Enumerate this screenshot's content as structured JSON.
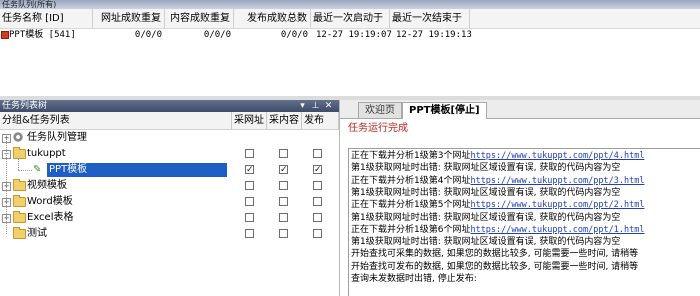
{
  "queue": {
    "title": "任务队列(所有)",
    "columns": [
      "任务名称 [ID]",
      "网址成败重复",
      "内容成败重复",
      "发布成败总数",
      "最近一次启动于",
      "最近一次结束于"
    ],
    "rows": [
      {
        "name": "PPT模板 [541]",
        "url_stats": "0/0/0",
        "content_stats": "0/0/0",
        "publish_stats": "0/0/0",
        "last_start": "12-27 19:19:07",
        "last_end": "12-27 19:19:13"
      }
    ]
  },
  "tree": {
    "title": "任务列表树",
    "title_buttons": [
      "▾",
      "⊥",
      "✕"
    ],
    "columns": [
      "分组&任务列表",
      "采网址",
      "采内容",
      "发布"
    ],
    "items": [
      {
        "label": "任务队列管理",
        "kind": "gear",
        "expander": "+",
        "level": 0,
        "checks": [],
        "selected": false
      },
      {
        "label": "tukuppt",
        "kind": "folder",
        "expander": "−",
        "level": 0,
        "checks": [
          false,
          false,
          false
        ],
        "selected": false
      },
      {
        "label": "PPT模板",
        "kind": "task",
        "expander": "",
        "level": 1,
        "checks": [
          true,
          true,
          true
        ],
        "selected": true
      },
      {
        "label": "视频模板",
        "kind": "folder",
        "expander": "+",
        "level": 0,
        "checks": [
          false,
          false,
          false
        ],
        "selected": false
      },
      {
        "label": "Word模板",
        "kind": "folder",
        "expander": "+",
        "level": 0,
        "checks": [
          false,
          false,
          false
        ],
        "selected": false
      },
      {
        "label": "Excel表格",
        "kind": "folder",
        "expander": "+",
        "level": 0,
        "checks": [
          false,
          false,
          false
        ],
        "selected": false
      },
      {
        "label": "测试",
        "kind": "folder",
        "expander": "",
        "level": 0,
        "checks": [
          false,
          false,
          false
        ],
        "selected": false
      }
    ],
    "check_mark": "✓"
  },
  "tabs": [
    {
      "label": "欢迎页",
      "active": false
    },
    {
      "label": "PPT模板[停止]",
      "active": true
    }
  ],
  "status": "任务运行完成",
  "log": [
    {
      "text": "正在下载并分析1级第3个网址",
      "link": "https://www.tukuppt.com/ppt/4.html"
    },
    {
      "text": "第1级获取网址时出错: 获取网址区域设置有误, 获取的代码内容为空",
      "link": ""
    },
    {
      "text": "正在下载并分析1级第4个网址",
      "link": "https://www.tukuppt.com/ppt/3.html"
    },
    {
      "text": "第1级获取网址时出错: 获取网址区域设置有误, 获取的代码内容为空",
      "link": ""
    },
    {
      "text": "正在下载并分析1级第5个网址",
      "link": "https://www.tukuppt.com/ppt/2.html"
    },
    {
      "text": "第1级获取网址时出错: 获取网址区域设置有误, 获取的代码内容为空",
      "link": ""
    },
    {
      "text": "正在下载并分析1级第6个网址",
      "link": "https://www.tukuppt.com/ppt/1.html"
    },
    {
      "text": "第1级获取网址时出错: 获取网址区域设置有误, 获取的代码内容为空",
      "link": ""
    },
    {
      "text": "开始查找可采集的数据, 如果您的数据比较多, 可能需要一些时间, 请稍等",
      "link": ""
    },
    {
      "text": "开始查找可发布的数据, 如果您的数据比较多, 可能需要一些时间, 请稍等",
      "link": ""
    },
    {
      "text": "查询未发数据时出错, 停止发布:",
      "link": ""
    }
  ]
}
